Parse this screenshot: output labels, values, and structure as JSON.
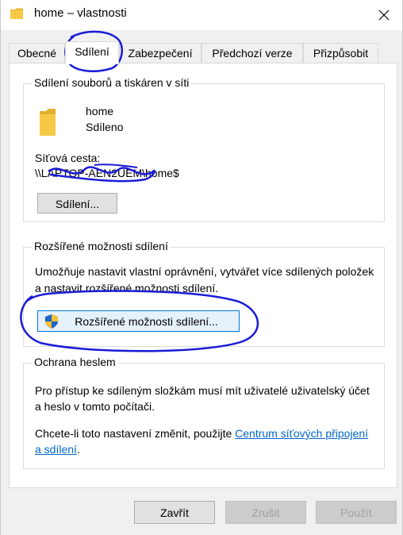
{
  "window": {
    "title": "home – vlastnosti",
    "close_glyph": "✕"
  },
  "tabs": [
    {
      "label": "Obecné",
      "active": false
    },
    {
      "label": "Sdílení",
      "active": true
    },
    {
      "label": "Zabezpečení",
      "active": false
    },
    {
      "label": "Předchozí verze",
      "active": false
    },
    {
      "label": "Přizpůsobit",
      "active": false
    }
  ],
  "network_sharing": {
    "title": "Sdílení souborů a tiskáren v síti",
    "folder_name": "home",
    "folder_status": "Sdíleno",
    "path_label": "Síťová cesta:",
    "path_value": "\\\\LAPTOP-AEN2UEM\\home$",
    "share_button": "Sdílení..."
  },
  "advanced_sharing": {
    "title": "Rozšířené možnosti sdílení",
    "description": "Umožňuje nastavit vlastní oprávnění, vytvářet více sdílených položek a nastavit rozšířené možnosti sdílení.",
    "button": "Rozšířené možnosti sdílení..."
  },
  "password_protection": {
    "title": "Ochrana heslem",
    "description": "Pro přístup ke sdíleným složkám musí mít uživatelé uživatelský účet a heslo v tomto počítači.",
    "change_text": "Chcete-li toto nastavení změnit, použijte ",
    "link_text": "Centrum síťových připojení a sdílení",
    "after_link": "."
  },
  "footer": {
    "close": "Zavřít",
    "cancel": "Zrušit",
    "apply": "Použít"
  },
  "colors": {
    "annotation": "#1a1ad6",
    "link": "#0066cc",
    "folder": "#f6c945"
  }
}
